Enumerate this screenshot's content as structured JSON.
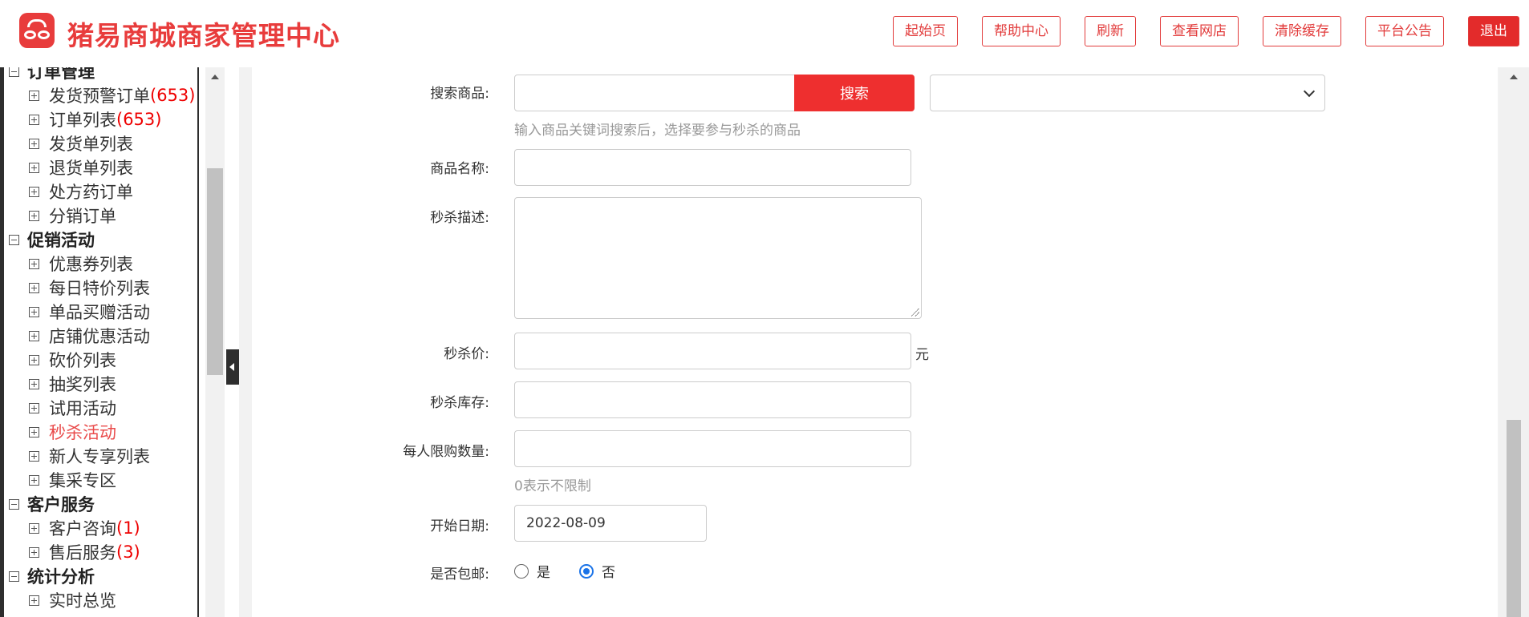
{
  "header": {
    "title": "猪易商城商家管理中心",
    "nav": [
      "起始页",
      "帮助中心",
      "刷新",
      "查看网店",
      "清除缓存",
      "平台公告"
    ],
    "logout": "退出"
  },
  "sidebar": {
    "groups": [
      {
        "title": "订单管理",
        "items": [
          {
            "label": "发货预警订单",
            "count": "(653)"
          },
          {
            "label": "订单列表",
            "count": "(653)"
          },
          {
            "label": "发货单列表",
            "count": ""
          },
          {
            "label": "退货单列表",
            "count": ""
          },
          {
            "label": "处方药订单",
            "count": ""
          },
          {
            "label": "分销订单",
            "count": ""
          }
        ]
      },
      {
        "title": "促销活动",
        "items": [
          {
            "label": "优惠券列表",
            "count": ""
          },
          {
            "label": "每日特价列表",
            "count": ""
          },
          {
            "label": "单品买赠活动",
            "count": ""
          },
          {
            "label": "店铺优惠活动",
            "count": ""
          },
          {
            "label": "砍价列表",
            "count": ""
          },
          {
            "label": "抽奖列表",
            "count": ""
          },
          {
            "label": "试用活动",
            "count": ""
          },
          {
            "label": "秒杀活动",
            "count": "",
            "active": true
          },
          {
            "label": "新人专享列表",
            "count": ""
          },
          {
            "label": "集采专区",
            "count": ""
          }
        ]
      },
      {
        "title": "客户服务",
        "items": [
          {
            "label": "客户咨询",
            "count": "(1)"
          },
          {
            "label": "售后服务",
            "count": "(3)"
          }
        ]
      },
      {
        "title": "统计分析",
        "items": [
          {
            "label": "实时总览",
            "count": ""
          }
        ]
      }
    ]
  },
  "form": {
    "search_goods_label": "搜索商品:",
    "search_input_value": "",
    "search_button": "搜索",
    "select_value": "",
    "search_hint": "输入商品关键词搜索后，选择要参与秒杀的商品",
    "goods_name_label": "商品名称:",
    "goods_name_value": "",
    "desc_label": "秒杀描述:",
    "price_label": "秒杀价:",
    "price_value": "",
    "price_unit": "元",
    "stock_label": "秒杀库存:",
    "stock_value": "",
    "limit_label": "每人限购数量:",
    "limit_value": "",
    "limit_hint": "0表示不限制",
    "start_date_label": "开始日期:",
    "start_date_value": "2022-08-09",
    "free_shipping_label": "是否包邮:",
    "free_shipping_yes": "是",
    "free_shipping_no": "否",
    "free_shipping_selected": "否"
  },
  "colors": {
    "brand_red": "#e83c3c",
    "sidebar_dark": "#2e2e2e",
    "radio_blue": "#1a73e8"
  }
}
